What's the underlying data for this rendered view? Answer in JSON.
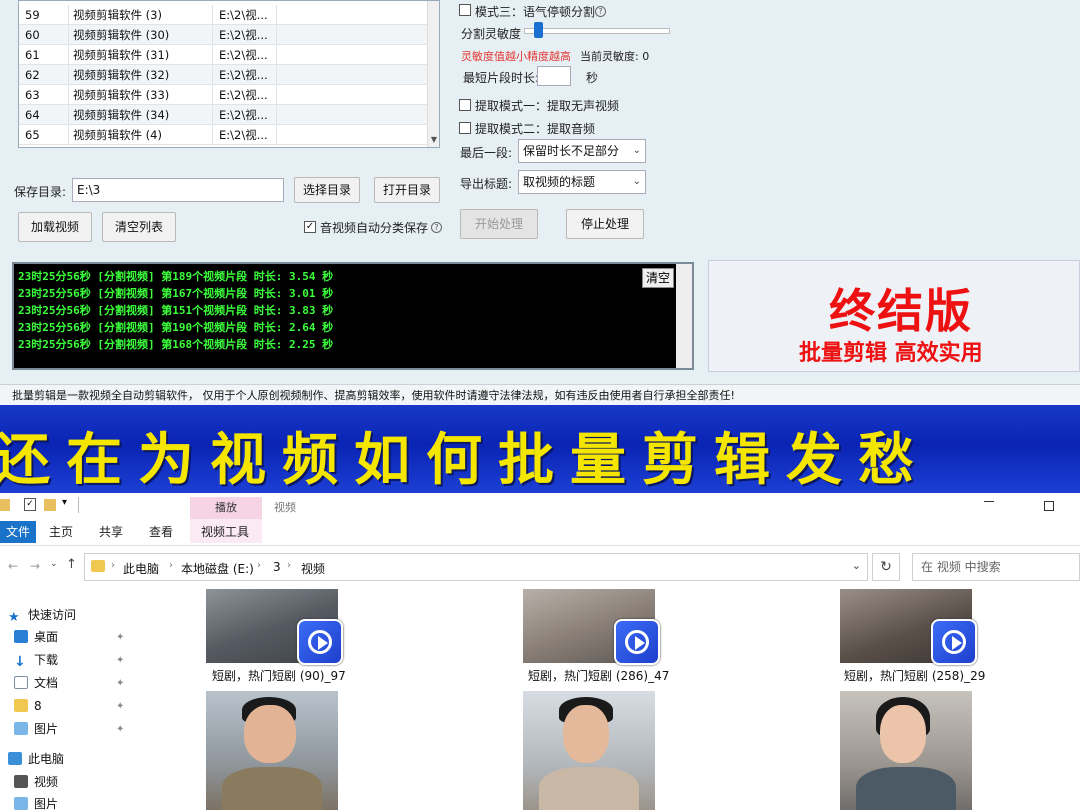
{
  "file_list": {
    "rows": [
      {
        "num": "59",
        "name": "视频剪辑软件 (3)",
        "path": "E:\\2\\视..."
      },
      {
        "num": "60",
        "name": "视频剪辑软件 (30)",
        "path": "E:\\2\\视..."
      },
      {
        "num": "61",
        "name": "视频剪辑软件 (31)",
        "path": "E:\\2\\视..."
      },
      {
        "num": "62",
        "name": "视频剪辑软件 (32)",
        "path": "E:\\2\\视..."
      },
      {
        "num": "63",
        "name": "视频剪辑软件 (33)",
        "path": "E:\\2\\视..."
      },
      {
        "num": "64",
        "name": "视频剪辑软件 (34)",
        "path": "E:\\2\\视..."
      },
      {
        "num": "65",
        "name": "视频剪辑软件 (4)",
        "path": "E:\\2\\视..."
      }
    ]
  },
  "save_dir": {
    "label": "保存目录:",
    "value": "E:\\3",
    "select_btn": "选择目录",
    "open_btn": "打开目录"
  },
  "buttons": {
    "load_video": "加载视频",
    "clear_list": "清空列表",
    "start": "开始处理",
    "stop": "停止处理"
  },
  "auto_save": {
    "label": "音视频自动分类保存",
    "checked": true
  },
  "settings": {
    "mode3_label": "模式三：语气停顿分割",
    "sensitivity_label": "分割灵敏度",
    "sensitivity_hint": "灵敏度值越小精度越高",
    "current_sensitivity": "当前灵敏度: 0",
    "min_clip_label": "最短片段时长:",
    "min_clip_unit": "秒",
    "extract1_label": "提取模式一：提取无声视频",
    "extract2_label": "提取模式二：提取音频",
    "last_segment_label": "最后一段:",
    "last_segment_value": "保留时长不足部分",
    "export_title_label": "导出标题:",
    "export_title_value": "取视频的标题"
  },
  "log": {
    "clear_label": "清空",
    "lines": [
      "23时25分56秒 [分割视频] 第189个视频片段 时长: 3.54 秒",
      "23时25分56秒 [分割视频] 第167个视频片段 时长: 3.01 秒",
      "23时25分56秒 [分割视频] 第151个视频片段 时长: 3.83 秒",
      "23时25分56秒 [分割视频] 第190个视频片段 时长: 2.64 秒",
      "23时25分56秒 [分割视频] 第168个视频片段 时长: 2.25 秒"
    ]
  },
  "promo": {
    "title": "终结版",
    "subtitle": "批量剪辑 高效实用"
  },
  "disclaimer": "批量剪辑是一款视频全自动剪辑软件， 仅用于个人原创视频制作、提高剪辑效率，使用软件时请遵守法律法规，如有违反由使用者自行承担全部责任!",
  "banner": "还在为视频如何批量剪辑发愁",
  "explorer": {
    "context_tab": "播放",
    "window_title": "视频",
    "tabs": [
      "文件",
      "主页",
      "共享",
      "查看",
      "视频工具"
    ],
    "breadcrumb": [
      "此电脑",
      "本地磁盘 (E:)",
      "3",
      "视频"
    ],
    "search_placeholder": "在 视频 中搜索",
    "nav": [
      {
        "label": "快速访问",
        "icon": "star-icon"
      },
      {
        "label": "桌面",
        "icon": "desktop-icon"
      },
      {
        "label": "下载",
        "icon": "download-icon"
      },
      {
        "label": "文档",
        "icon": "document-icon"
      },
      {
        "label": "8",
        "icon": "folder-icon"
      },
      {
        "label": "图片",
        "icon": "pictures-icon"
      },
      {
        "label": "此电脑",
        "icon": "computer-icon"
      },
      {
        "label": "视频",
        "icon": "videos-icon"
      },
      {
        "label": "图片",
        "icon": "pictures-icon"
      }
    ],
    "files": [
      {
        "name": "短剧，热门短剧 (90)_97"
      },
      {
        "name": "短剧，热门短剧 (286)_47"
      },
      {
        "name": "短剧，热门短剧 (258)_29"
      }
    ]
  },
  "colors": {
    "log_text": "#3cff3c",
    "promo_red": "#e11111",
    "banner_bg": "#0a24b4",
    "banner_text": "#f5e600",
    "explorer_accent": "#1a73c8"
  }
}
